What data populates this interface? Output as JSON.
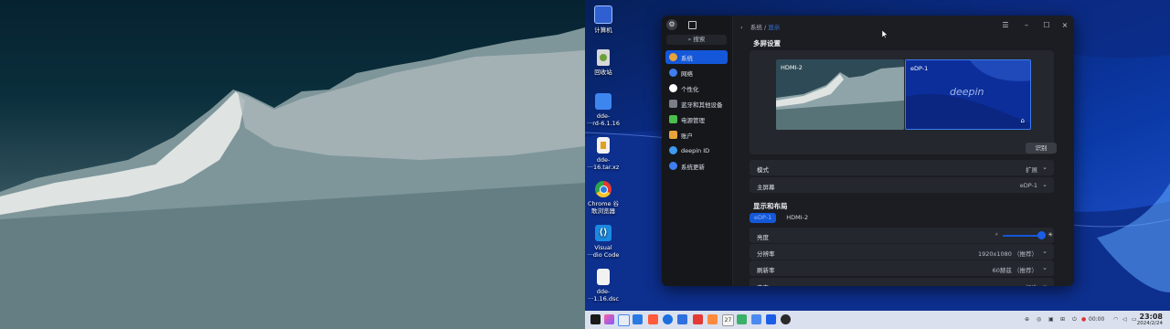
{
  "desktop": {
    "icons": [
      {
        "label": "计算机",
        "icon": "computer-icon"
      },
      {
        "label": "回收站",
        "icon": "trash-icon"
      },
      {
        "label": "dde-\n···rd-6.1.16",
        "icon": "folder-icon"
      },
      {
        "label": "dde-\n···16.tar.xz",
        "icon": "archive-icon"
      },
      {
        "label": "Chrome 谷\n歌浏览器",
        "icon": "chrome-icon"
      },
      {
        "label": "Visual\n···dio Code",
        "icon": "vscode-icon"
      },
      {
        "label": "dde-\n···1.16.dsc",
        "icon": "document-icon"
      }
    ]
  },
  "settings": {
    "search_placeholder": "搜索",
    "breadcrumb": {
      "root": "系统",
      "sep": "/",
      "current": "显示"
    },
    "nav": [
      {
        "label": "系统",
        "icon": "system-icon",
        "color": "#e8a43a",
        "active": true
      },
      {
        "label": "网络",
        "icon": "network-icon",
        "color": "#3f7ef0",
        "active": false
      },
      {
        "label": "个性化",
        "icon": "personalization-icon",
        "color": "#ffffff",
        "active": false
      },
      {
        "label": "蓝牙和其他设备",
        "icon": "bluetooth-icon",
        "color": "#7a7f88",
        "active": false
      },
      {
        "label": "电源管理",
        "icon": "power-icon",
        "color": "#4cbf4c",
        "active": false
      },
      {
        "label": "账户",
        "icon": "account-icon",
        "color": "#e8a43a",
        "active": false
      },
      {
        "label": "deepin ID",
        "icon": "cloud-icon",
        "color": "#3f9af0",
        "active": false
      },
      {
        "label": "系统更新",
        "icon": "update-icon",
        "color": "#3f7ef0",
        "active": false
      }
    ],
    "multi_screen": {
      "title": "多屏设置",
      "monitors": [
        "HDMI-2",
        "eDP-1"
      ],
      "identify_button": "识别"
    },
    "mode": {
      "label": "模式",
      "value": "扩展"
    },
    "primary": {
      "label": "主屏幕",
      "value": "eDP-1"
    },
    "display_layout": {
      "title": "显示和布局",
      "tabs": [
        "eDP-1",
        "HDMI-2"
      ]
    },
    "brightness": {
      "label": "亮度",
      "value_fraction": 0.93
    },
    "resolution": {
      "label": "分辨率",
      "value": "1920x1080 （推荐）"
    },
    "refresh_rate": {
      "label": "刷新率",
      "value": "60赫兹 （推荐）"
    },
    "rotation": {
      "label": "方向",
      "value": "标准"
    }
  },
  "taskbar": {
    "time": "23:08",
    "date": "2024/2/24",
    "tray_text": "00:00"
  },
  "colors": {
    "accent": "#1457d8",
    "window_bg": "#1b1d22"
  }
}
